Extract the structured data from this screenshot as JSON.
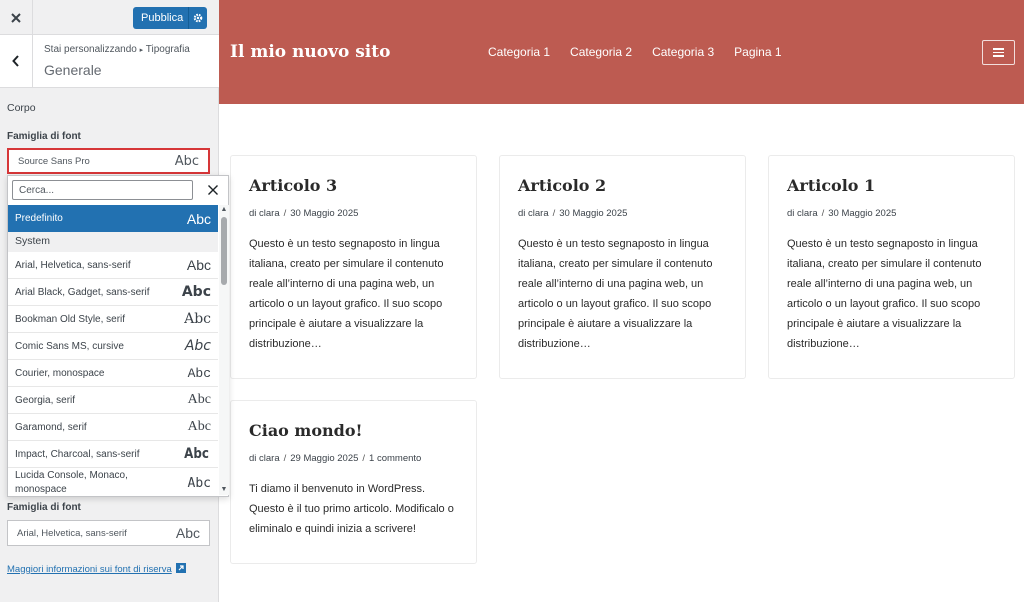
{
  "customizer": {
    "close_icon": "close-icon",
    "publish_label": "Pubblica",
    "back_icon": "chevron-left-icon",
    "breadcrumb_prefix": "Stai personalizzando",
    "breadcrumb_arrow": "▸",
    "breadcrumb_parent": "Tipografia",
    "section_title": "Generale",
    "group_label": "Corpo",
    "font_family_label": "Famiglia di font",
    "current_font": "Source Sans Pro",
    "current_font_preview": "Abc",
    "fallback_label": "Famiglia di font",
    "fallback_font": "Arial, Helvetica, sans-serif",
    "fallback_preview": "Abc",
    "fallback_link": "Maggiori informazioni sui font di riserva"
  },
  "dropdown": {
    "search_placeholder": "Cerca...",
    "selected": {
      "name": "Predefinito",
      "preview": "Abc"
    },
    "group_system": "System",
    "items": [
      {
        "name": "Arial, Helvetica, sans-serif",
        "preview": "Abc"
      },
      {
        "name": "Arial Black, Gadget, sans-serif",
        "preview": "Abc"
      },
      {
        "name": "Bookman Old Style, serif",
        "preview": "Abc"
      },
      {
        "name": "Comic Sans MS, cursive",
        "preview": "Abc"
      },
      {
        "name": "Courier, monospace",
        "preview": "Abc"
      },
      {
        "name": "Georgia, serif",
        "preview": "Abc"
      },
      {
        "name": "Garamond, serif",
        "preview": "Abc"
      },
      {
        "name": "Impact, Charcoal, sans-serif",
        "preview": "Abc"
      },
      {
        "name": "Lucida Console, Monaco, monospace",
        "preview": "Abc"
      }
    ]
  },
  "site": {
    "title": "Il mio nuovo sito",
    "nav": [
      "Categoria 1",
      "Categoria 2",
      "Categoria 3",
      "Pagina 1"
    ],
    "header_color": "#bd5b51",
    "posts": [
      {
        "title": "Articolo 3",
        "author": "di clara",
        "date": "30 Maggio 2025",
        "comments": "",
        "excerpt": "Questo è un testo segnaposto in lingua italiana, creato per simulare il contenuto reale all’interno di una pagina web, un articolo o un layout grafico. Il suo scopo principale è aiutare a visualizzare la distribuzione…"
      },
      {
        "title": "Articolo 2",
        "author": "di clara",
        "date": "30 Maggio 2025",
        "comments": "",
        "excerpt": "Questo è un testo segnaposto in lingua italiana, creato per simulare il contenuto reale all’interno di una pagina web, un articolo o un layout grafico. Il suo scopo principale è aiutare a visualizzare la distribuzione…"
      },
      {
        "title": "Articolo 1",
        "author": "di clara",
        "date": "30 Maggio 2025",
        "comments": "",
        "excerpt": "Questo è un testo segnaposto in lingua italiana, creato per simulare il contenuto reale all’interno di una pagina web, un articolo o un layout grafico. Il suo scopo principale è aiutare a visualizzare la distribuzione…"
      },
      {
        "title": "Ciao mondo!",
        "author": "di clara",
        "date": "29 Maggio 2025",
        "comments": "1 commento",
        "excerpt": "Ti diamo il benvenuto in WordPress. Questo è il tuo primo articolo. Modificalo o eliminalo e quindi inizia a scrivere!"
      }
    ]
  }
}
